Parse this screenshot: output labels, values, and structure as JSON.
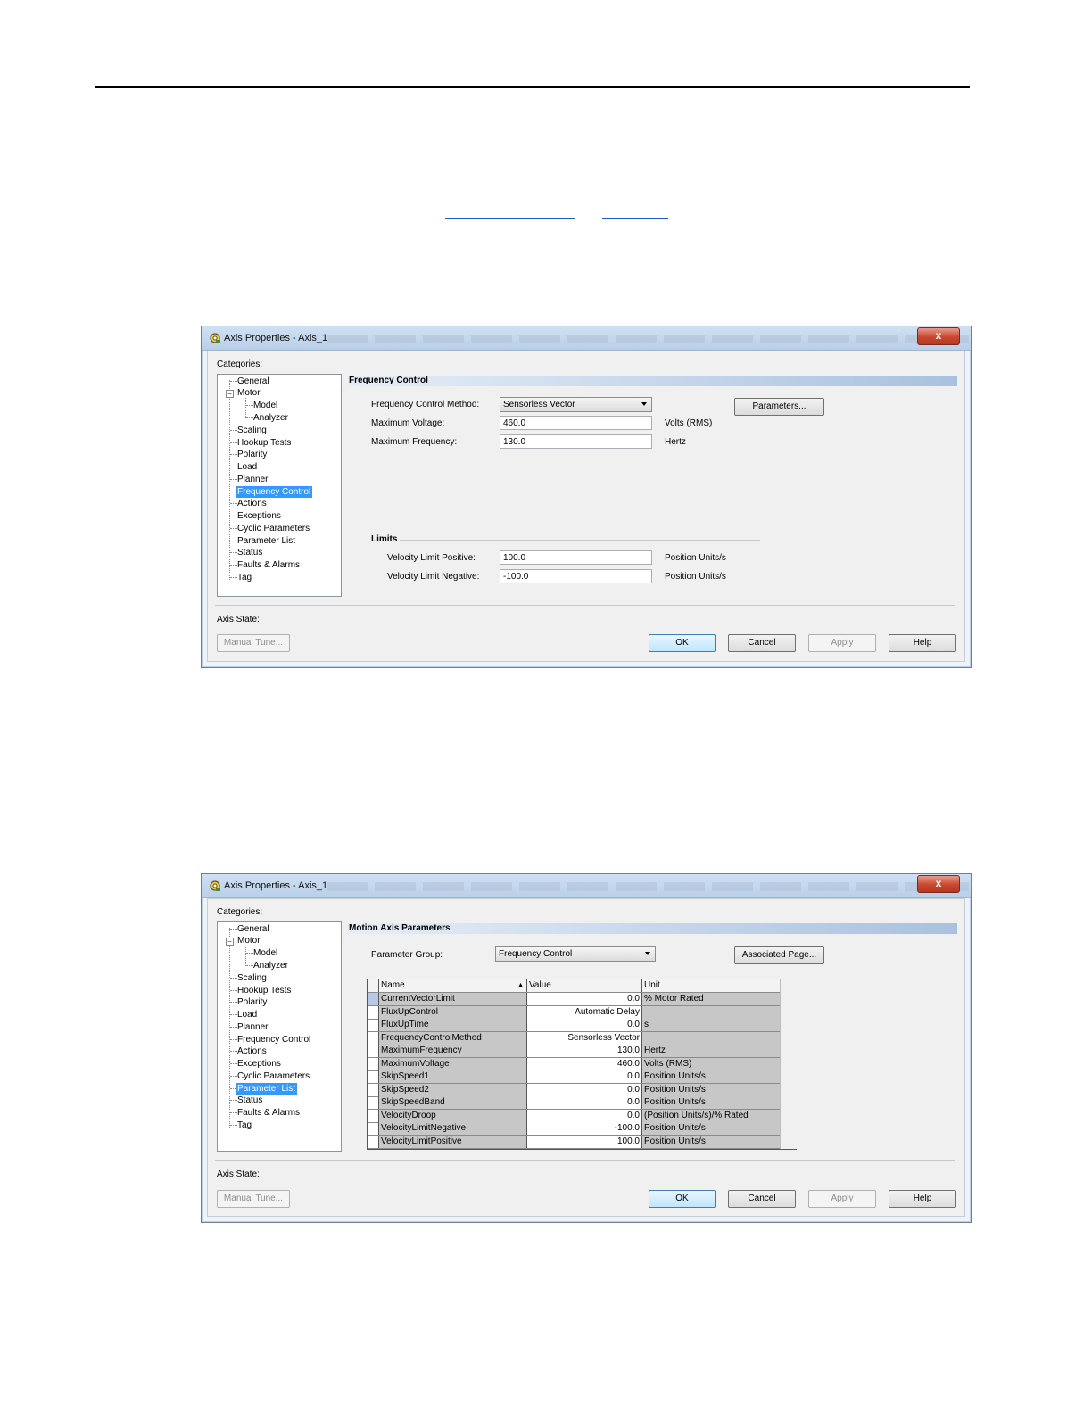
{
  "window1": {
    "title": "Axis Properties - Axis_1",
    "close_label": "x",
    "categories_label": "Categories:",
    "tree": [
      "General",
      "Motor",
      "Model",
      "Analyzer",
      "Scaling",
      "Hookup Tests",
      "Polarity",
      "Load",
      "Planner",
      "Frequency Control",
      "Actions",
      "Exceptions",
      "Cyclic Parameters",
      "Parameter List",
      "Status",
      "Faults & Alarms",
      "Tag"
    ],
    "selected": "Frequency Control",
    "section_title": "Frequency Control",
    "method_label": "Frequency Control Method:",
    "method_value": "Sensorless Vector",
    "parameters_button": "Parameters...",
    "max_voltage_label": "Maximum Voltage:",
    "max_voltage_value": "460.0",
    "max_voltage_unit": "Volts (RMS)",
    "max_freq_label": "Maximum Frequency:",
    "max_freq_value": "130.0",
    "max_freq_unit": "Hertz",
    "limits_label": "Limits",
    "vel_pos_label": "Velocity Limit Positive:",
    "vel_pos_value": "100.0",
    "vel_pos_unit": "Position Units/s",
    "vel_neg_label": "Velocity Limit Negative:",
    "vel_neg_value": "-100.0",
    "vel_neg_unit": "Position Units/s",
    "axis_state_label": "Axis State:",
    "manual_tune": "Manual Tune...",
    "ok": "OK",
    "cancel": "Cancel",
    "apply": "Apply",
    "help": "Help"
  },
  "window2": {
    "title": "Axis Properties - Axis_1",
    "close_label": "x",
    "categories_label": "Categories:",
    "tree": [
      "General",
      "Motor",
      "Model",
      "Analyzer",
      "Scaling",
      "Hookup Tests",
      "Polarity",
      "Load",
      "Planner",
      "Frequency Control",
      "Actions",
      "Exceptions",
      "Cyclic Parameters",
      "Parameter List",
      "Status",
      "Faults & Alarms",
      "Tag"
    ],
    "selected": "Parameter List",
    "section_title": "Motion Axis Parameters",
    "group_label": "Parameter Group:",
    "group_value": "Frequency Control",
    "associated_button": "Associated Page...",
    "columns": {
      "name": "Name",
      "sort": "▲",
      "value": "Value",
      "unit": "Unit"
    },
    "rows": [
      {
        "name": "CurrentVectorLimit",
        "value": "0.0",
        "unit": "% Motor Rated"
      },
      {
        "name": "FluxUpControl",
        "value": "Automatic Delay",
        "unit": ""
      },
      {
        "name": "FluxUpTime",
        "value": "0.0",
        "unit": "s"
      },
      {
        "name": "FrequencyControlMethod",
        "value": "Sensorless Vector",
        "unit": ""
      },
      {
        "name": "MaximumFrequency",
        "value": "130.0",
        "unit": "Hertz"
      },
      {
        "name": "MaximumVoltage",
        "value": "460.0",
        "unit": "Volts (RMS)"
      },
      {
        "name": "SkipSpeed1",
        "value": "0.0",
        "unit": "Position Units/s"
      },
      {
        "name": "SkipSpeed2",
        "value": "0.0",
        "unit": "Position Units/s"
      },
      {
        "name": "SkipSpeedBand",
        "value": "0.0",
        "unit": "Position Units/s"
      },
      {
        "name": "VelocityDroop",
        "value": "0.0",
        "unit": "(Position Units/s)/% Rated"
      },
      {
        "name": "VelocityLimitNegative",
        "value": "-100.0",
        "unit": "Position Units/s"
      },
      {
        "name": "VelocityLimitPositive",
        "value": "100.0",
        "unit": "Position Units/s"
      }
    ],
    "axis_state_label": "Axis State:",
    "manual_tune": "Manual Tune...",
    "ok": "OK",
    "cancel": "Cancel",
    "apply": "Apply",
    "help": "Help"
  }
}
